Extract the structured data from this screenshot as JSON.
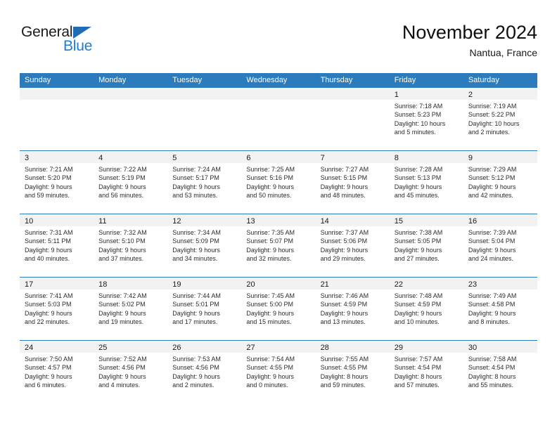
{
  "brand": {
    "name_primary": "General",
    "name_secondary": "Blue",
    "triangle_icon": "triangle-icon",
    "primary_color": "#1a1a1a",
    "secondary_color": "#1d7dd4"
  },
  "header": {
    "title": "November 2024",
    "location": "Nantua, France"
  },
  "theme": {
    "header_bar_color": "#2b7bbd",
    "day_band_color": "#f2f2f2",
    "row_divider_color": "#2b7bbd",
    "text_color": "#2b2b2b"
  },
  "calendar": {
    "weekdays": [
      "Sunday",
      "Monday",
      "Tuesday",
      "Wednesday",
      "Thursday",
      "Friday",
      "Saturday"
    ],
    "weeks": [
      [
        {
          "day": "",
          "empty": true,
          "lines": []
        },
        {
          "day": "",
          "empty": true,
          "lines": []
        },
        {
          "day": "",
          "empty": true,
          "lines": []
        },
        {
          "day": "",
          "empty": true,
          "lines": []
        },
        {
          "day": "",
          "empty": true,
          "lines": []
        },
        {
          "day": "1",
          "empty": false,
          "lines": [
            "Sunrise: 7:18 AM",
            "Sunset: 5:23 PM",
            "Daylight: 10 hours",
            "and 5 minutes."
          ]
        },
        {
          "day": "2",
          "empty": false,
          "lines": [
            "Sunrise: 7:19 AM",
            "Sunset: 5:22 PM",
            "Daylight: 10 hours",
            "and 2 minutes."
          ]
        }
      ],
      [
        {
          "day": "3",
          "empty": false,
          "lines": [
            "Sunrise: 7:21 AM",
            "Sunset: 5:20 PM",
            "Daylight: 9 hours",
            "and 59 minutes."
          ]
        },
        {
          "day": "4",
          "empty": false,
          "lines": [
            "Sunrise: 7:22 AM",
            "Sunset: 5:19 PM",
            "Daylight: 9 hours",
            "and 56 minutes."
          ]
        },
        {
          "day": "5",
          "empty": false,
          "lines": [
            "Sunrise: 7:24 AM",
            "Sunset: 5:17 PM",
            "Daylight: 9 hours",
            "and 53 minutes."
          ]
        },
        {
          "day": "6",
          "empty": false,
          "lines": [
            "Sunrise: 7:25 AM",
            "Sunset: 5:16 PM",
            "Daylight: 9 hours",
            "and 50 minutes."
          ]
        },
        {
          "day": "7",
          "empty": false,
          "lines": [
            "Sunrise: 7:27 AM",
            "Sunset: 5:15 PM",
            "Daylight: 9 hours",
            "and 48 minutes."
          ]
        },
        {
          "day": "8",
          "empty": false,
          "lines": [
            "Sunrise: 7:28 AM",
            "Sunset: 5:13 PM",
            "Daylight: 9 hours",
            "and 45 minutes."
          ]
        },
        {
          "day": "9",
          "empty": false,
          "lines": [
            "Sunrise: 7:29 AM",
            "Sunset: 5:12 PM",
            "Daylight: 9 hours",
            "and 42 minutes."
          ]
        }
      ],
      [
        {
          "day": "10",
          "empty": false,
          "lines": [
            "Sunrise: 7:31 AM",
            "Sunset: 5:11 PM",
            "Daylight: 9 hours",
            "and 40 minutes."
          ]
        },
        {
          "day": "11",
          "empty": false,
          "lines": [
            "Sunrise: 7:32 AM",
            "Sunset: 5:10 PM",
            "Daylight: 9 hours",
            "and 37 minutes."
          ]
        },
        {
          "day": "12",
          "empty": false,
          "lines": [
            "Sunrise: 7:34 AM",
            "Sunset: 5:09 PM",
            "Daylight: 9 hours",
            "and 34 minutes."
          ]
        },
        {
          "day": "13",
          "empty": false,
          "lines": [
            "Sunrise: 7:35 AM",
            "Sunset: 5:07 PM",
            "Daylight: 9 hours",
            "and 32 minutes."
          ]
        },
        {
          "day": "14",
          "empty": false,
          "lines": [
            "Sunrise: 7:37 AM",
            "Sunset: 5:06 PM",
            "Daylight: 9 hours",
            "and 29 minutes."
          ]
        },
        {
          "day": "15",
          "empty": false,
          "lines": [
            "Sunrise: 7:38 AM",
            "Sunset: 5:05 PM",
            "Daylight: 9 hours",
            "and 27 minutes."
          ]
        },
        {
          "day": "16",
          "empty": false,
          "lines": [
            "Sunrise: 7:39 AM",
            "Sunset: 5:04 PM",
            "Daylight: 9 hours",
            "and 24 minutes."
          ]
        }
      ],
      [
        {
          "day": "17",
          "empty": false,
          "lines": [
            "Sunrise: 7:41 AM",
            "Sunset: 5:03 PM",
            "Daylight: 9 hours",
            "and 22 minutes."
          ]
        },
        {
          "day": "18",
          "empty": false,
          "lines": [
            "Sunrise: 7:42 AM",
            "Sunset: 5:02 PM",
            "Daylight: 9 hours",
            "and 19 minutes."
          ]
        },
        {
          "day": "19",
          "empty": false,
          "lines": [
            "Sunrise: 7:44 AM",
            "Sunset: 5:01 PM",
            "Daylight: 9 hours",
            "and 17 minutes."
          ]
        },
        {
          "day": "20",
          "empty": false,
          "lines": [
            "Sunrise: 7:45 AM",
            "Sunset: 5:00 PM",
            "Daylight: 9 hours",
            "and 15 minutes."
          ]
        },
        {
          "day": "21",
          "empty": false,
          "lines": [
            "Sunrise: 7:46 AM",
            "Sunset: 4:59 PM",
            "Daylight: 9 hours",
            "and 13 minutes."
          ]
        },
        {
          "day": "22",
          "empty": false,
          "lines": [
            "Sunrise: 7:48 AM",
            "Sunset: 4:59 PM",
            "Daylight: 9 hours",
            "and 10 minutes."
          ]
        },
        {
          "day": "23",
          "empty": false,
          "lines": [
            "Sunrise: 7:49 AM",
            "Sunset: 4:58 PM",
            "Daylight: 9 hours",
            "and 8 minutes."
          ]
        }
      ],
      [
        {
          "day": "24",
          "empty": false,
          "lines": [
            "Sunrise: 7:50 AM",
            "Sunset: 4:57 PM",
            "Daylight: 9 hours",
            "and 6 minutes."
          ]
        },
        {
          "day": "25",
          "empty": false,
          "lines": [
            "Sunrise: 7:52 AM",
            "Sunset: 4:56 PM",
            "Daylight: 9 hours",
            "and 4 minutes."
          ]
        },
        {
          "day": "26",
          "empty": false,
          "lines": [
            "Sunrise: 7:53 AM",
            "Sunset: 4:56 PM",
            "Daylight: 9 hours",
            "and 2 minutes."
          ]
        },
        {
          "day": "27",
          "empty": false,
          "lines": [
            "Sunrise: 7:54 AM",
            "Sunset: 4:55 PM",
            "Daylight: 9 hours",
            "and 0 minutes."
          ]
        },
        {
          "day": "28",
          "empty": false,
          "lines": [
            "Sunrise: 7:55 AM",
            "Sunset: 4:55 PM",
            "Daylight: 8 hours",
            "and 59 minutes."
          ]
        },
        {
          "day": "29",
          "empty": false,
          "lines": [
            "Sunrise: 7:57 AM",
            "Sunset: 4:54 PM",
            "Daylight: 8 hours",
            "and 57 minutes."
          ]
        },
        {
          "day": "30",
          "empty": false,
          "lines": [
            "Sunrise: 7:58 AM",
            "Sunset: 4:54 PM",
            "Daylight: 8 hours",
            "and 55 minutes."
          ]
        }
      ]
    ]
  }
}
